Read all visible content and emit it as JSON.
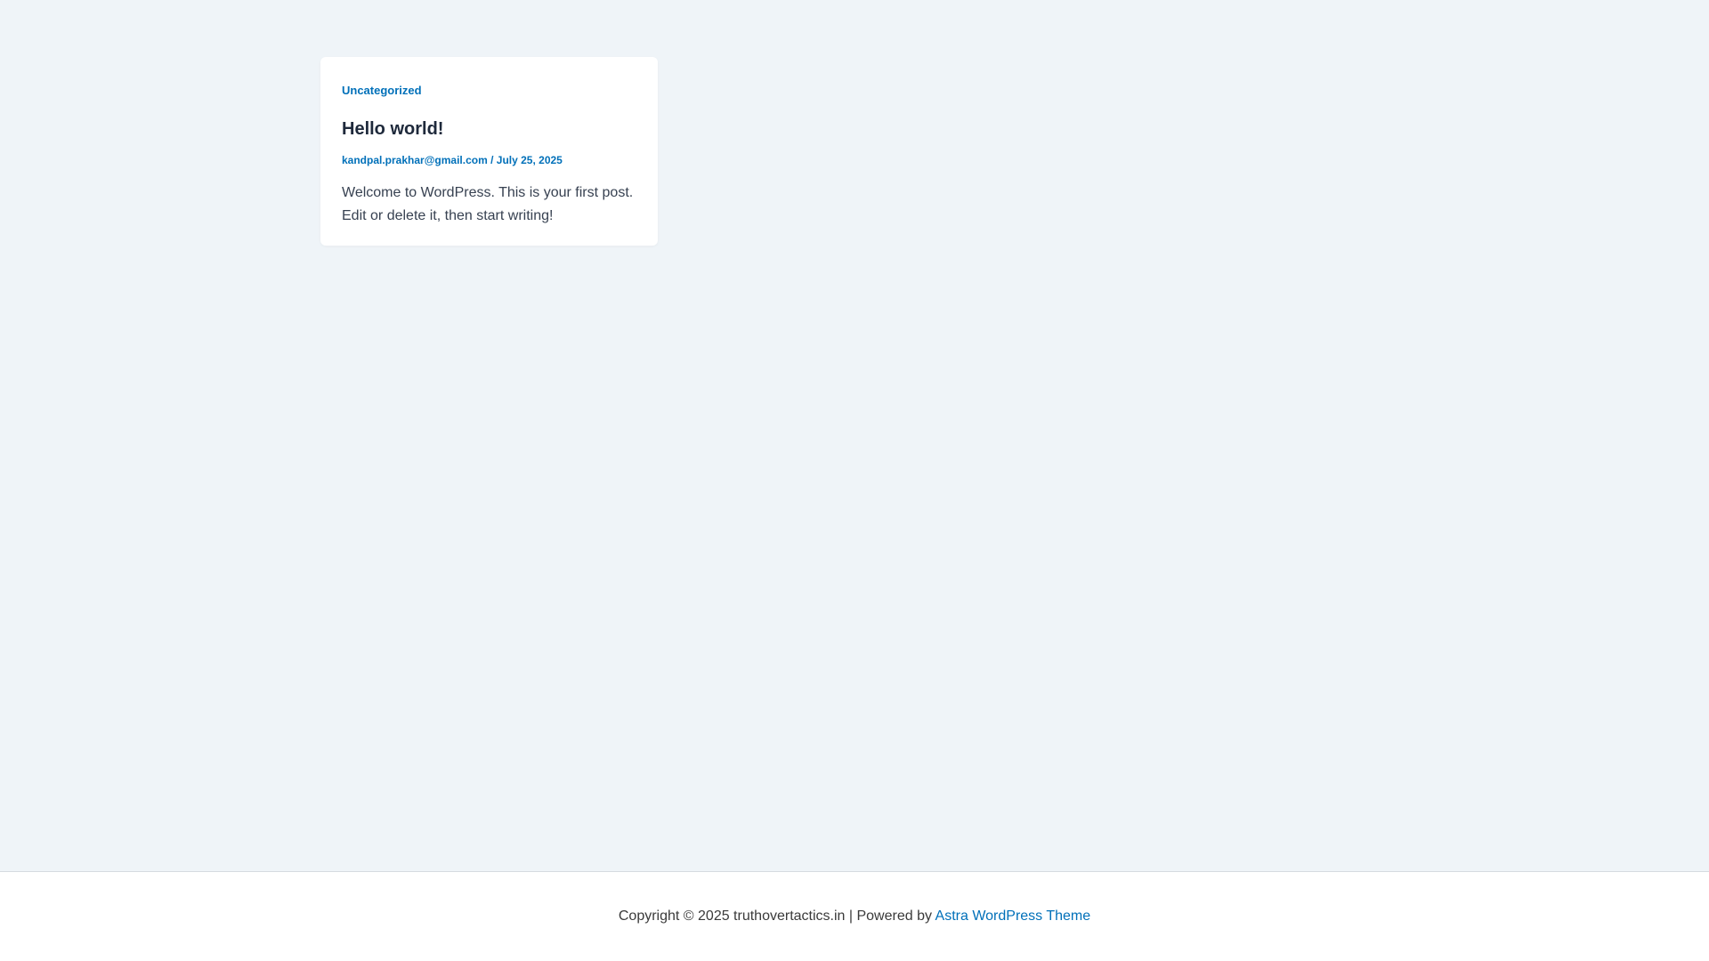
{
  "post": {
    "category": "Uncategorized",
    "title": "Hello world!",
    "author": "kandpal.prakhar@gmail.com",
    "meta_separator": " / ",
    "date": "July 25, 2025",
    "excerpt": "Welcome to WordPress. This is your first post. Edit or delete it, then start writing!"
  },
  "footer": {
    "copyright_text": "Copyright © 2025 truthovertactics.in | Powered by ",
    "theme_link": "Astra WordPress Theme"
  },
  "colors": {
    "page_background": "#eff4f8",
    "accent": "#0170b9",
    "title": "#1e293b"
  }
}
